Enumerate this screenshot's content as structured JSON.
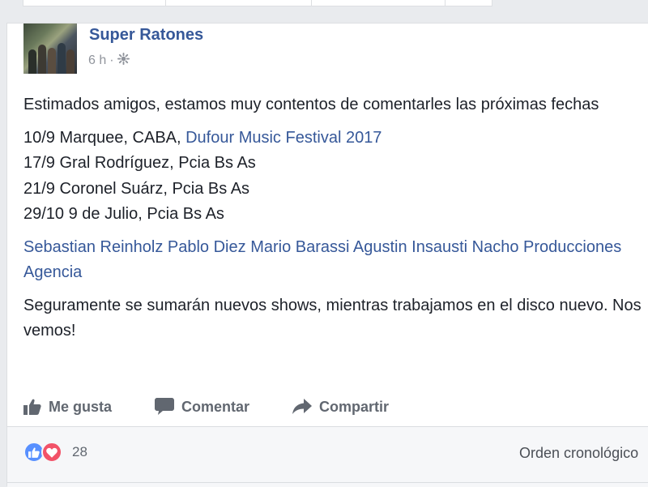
{
  "post": {
    "author": "Super Ratones",
    "time": "6 h",
    "time_separator": "·",
    "globe_icon": "globe-icon",
    "paragraphs": [
      {
        "text": "Estimados amigos, estamos muy contentos de comentarles las próximas fechas"
      }
    ],
    "dates": {
      "line1_prefix": "10/9 Marquee, CABA, ",
      "line1_link": "Dufour Music Festival 2017",
      "line2": "17/9 Gral Rodríguez, Pcia Bs As",
      "line3": "21/9 Coronel Suárz, Pcia Bs As",
      "line4": "29/10 9 de Julio, Pcia Bs As"
    },
    "tags": {
      "tag1": "Sebastian Reinholz",
      "tag2": "Pablo Diez",
      "tag3": "Mario Barassi",
      "tag4": "Agustin Insausti",
      "tag5": "Nacho Producciones Agencia"
    },
    "closing": "Seguramente se sumarán nuevos shows, mientras trabajamos en el disco nuevo. Nos vemos!"
  },
  "actions": {
    "like": "Me gusta",
    "comment": "Comentar",
    "share": "Compartir"
  },
  "reactions": {
    "count": "28",
    "types": [
      "like",
      "love"
    ],
    "like_color": "#5890ff",
    "love_color": "#f25268"
  },
  "comments": {
    "order_label": "Orden cronológico"
  },
  "colors": {
    "link": "#365899",
    "text": "#1d2129",
    "muted": "#90949c",
    "background": "#e9ebee"
  }
}
